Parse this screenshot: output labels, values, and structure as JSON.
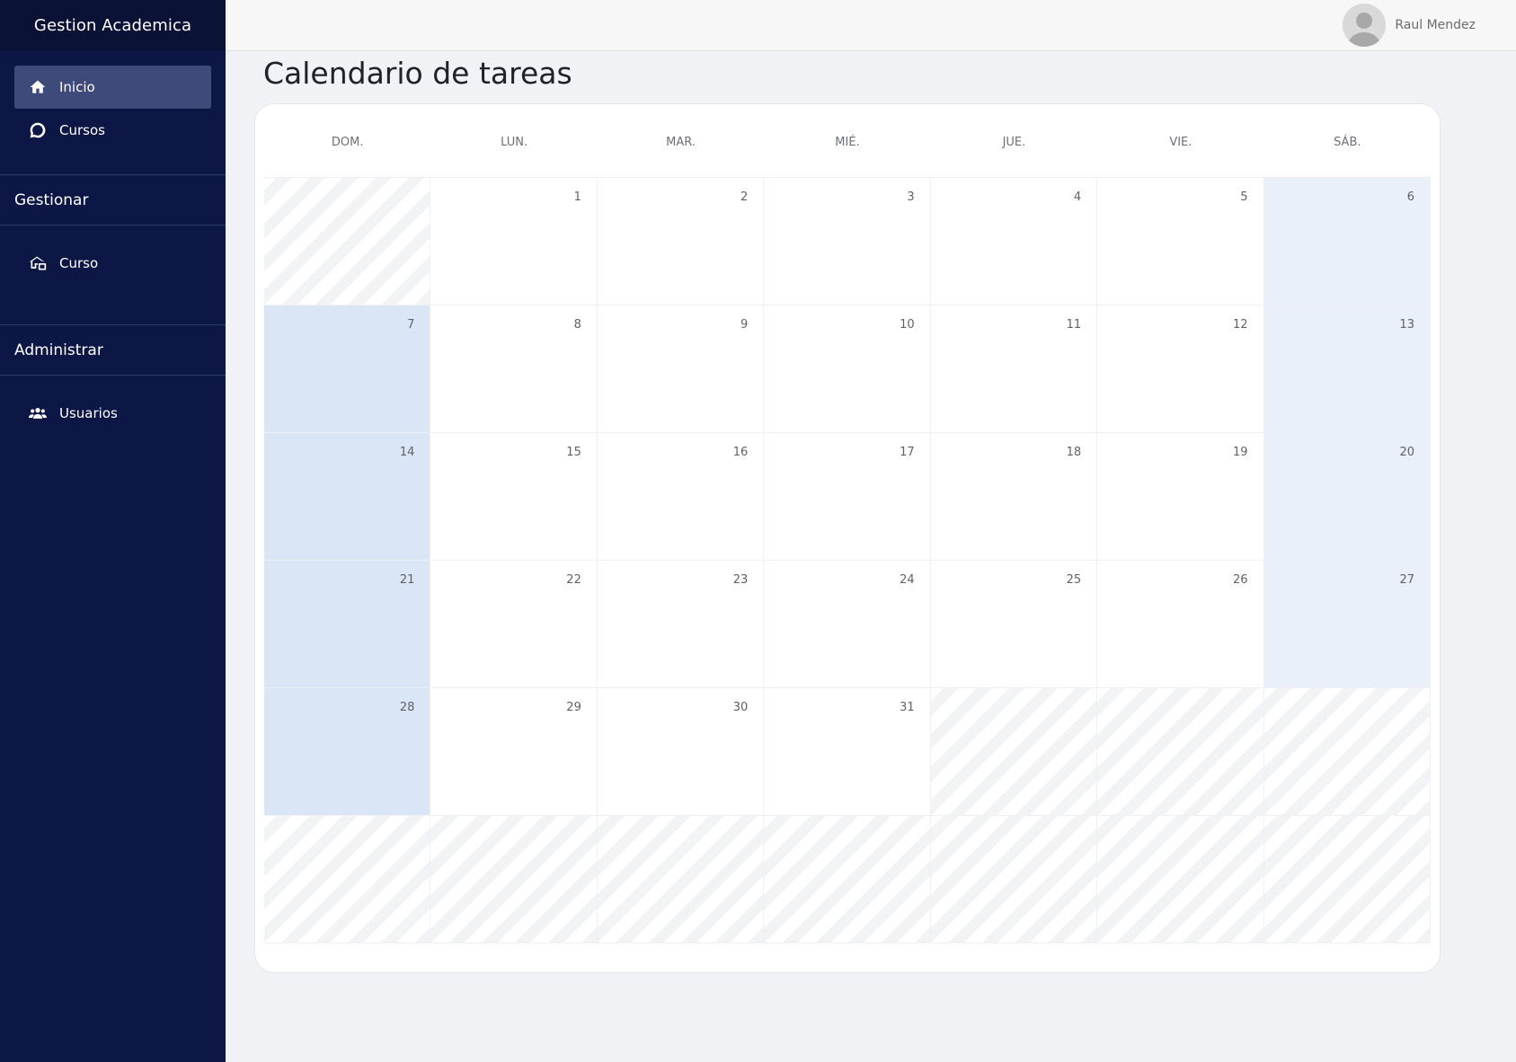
{
  "app": {
    "brand": "Gestion Academica"
  },
  "sidebar": {
    "items": [
      {
        "label": "Inicio",
        "icon": "home-icon",
        "active": true
      },
      {
        "label": "Cursos",
        "icon": "chat-icon",
        "active": false
      }
    ],
    "sections": [
      {
        "title": "Gestionar",
        "items": [
          {
            "label": "Curso",
            "icon": "course-icon"
          }
        ]
      },
      {
        "title": "Administrar",
        "items": [
          {
            "label": "Usuarios",
            "icon": "users-icon"
          }
        ]
      }
    ]
  },
  "topbar": {
    "user_name": "Raul Mendez",
    "avatar_icon": "user-avatar-icon"
  },
  "page": {
    "title": "Calendario de tareas"
  },
  "calendar": {
    "day_headers": [
      "DOM.",
      "LUN.",
      "MAR.",
      "MIÉ.",
      "JUE.",
      "VIE.",
      "SÁB."
    ],
    "weeks": [
      [
        "",
        "1",
        "2",
        "3",
        "4",
        "5",
        "6"
      ],
      [
        "7",
        "8",
        "9",
        "10",
        "11",
        "12",
        "13"
      ],
      [
        "14",
        "15",
        "16",
        "17",
        "18",
        "19",
        "20"
      ],
      [
        "21",
        "22",
        "23",
        "24",
        "25",
        "26",
        "27"
      ],
      [
        "28",
        "29",
        "30",
        "31",
        "",
        "",
        ""
      ],
      [
        "",
        "",
        "",
        "",
        "",
        "",
        ""
      ]
    ]
  },
  "colors": {
    "sidebar_bg": "#0d1745",
    "active_item_bg": "#3e4a79",
    "sunday_bg": "#dae5f6",
    "saturday_bg": "#e9f0fa"
  }
}
